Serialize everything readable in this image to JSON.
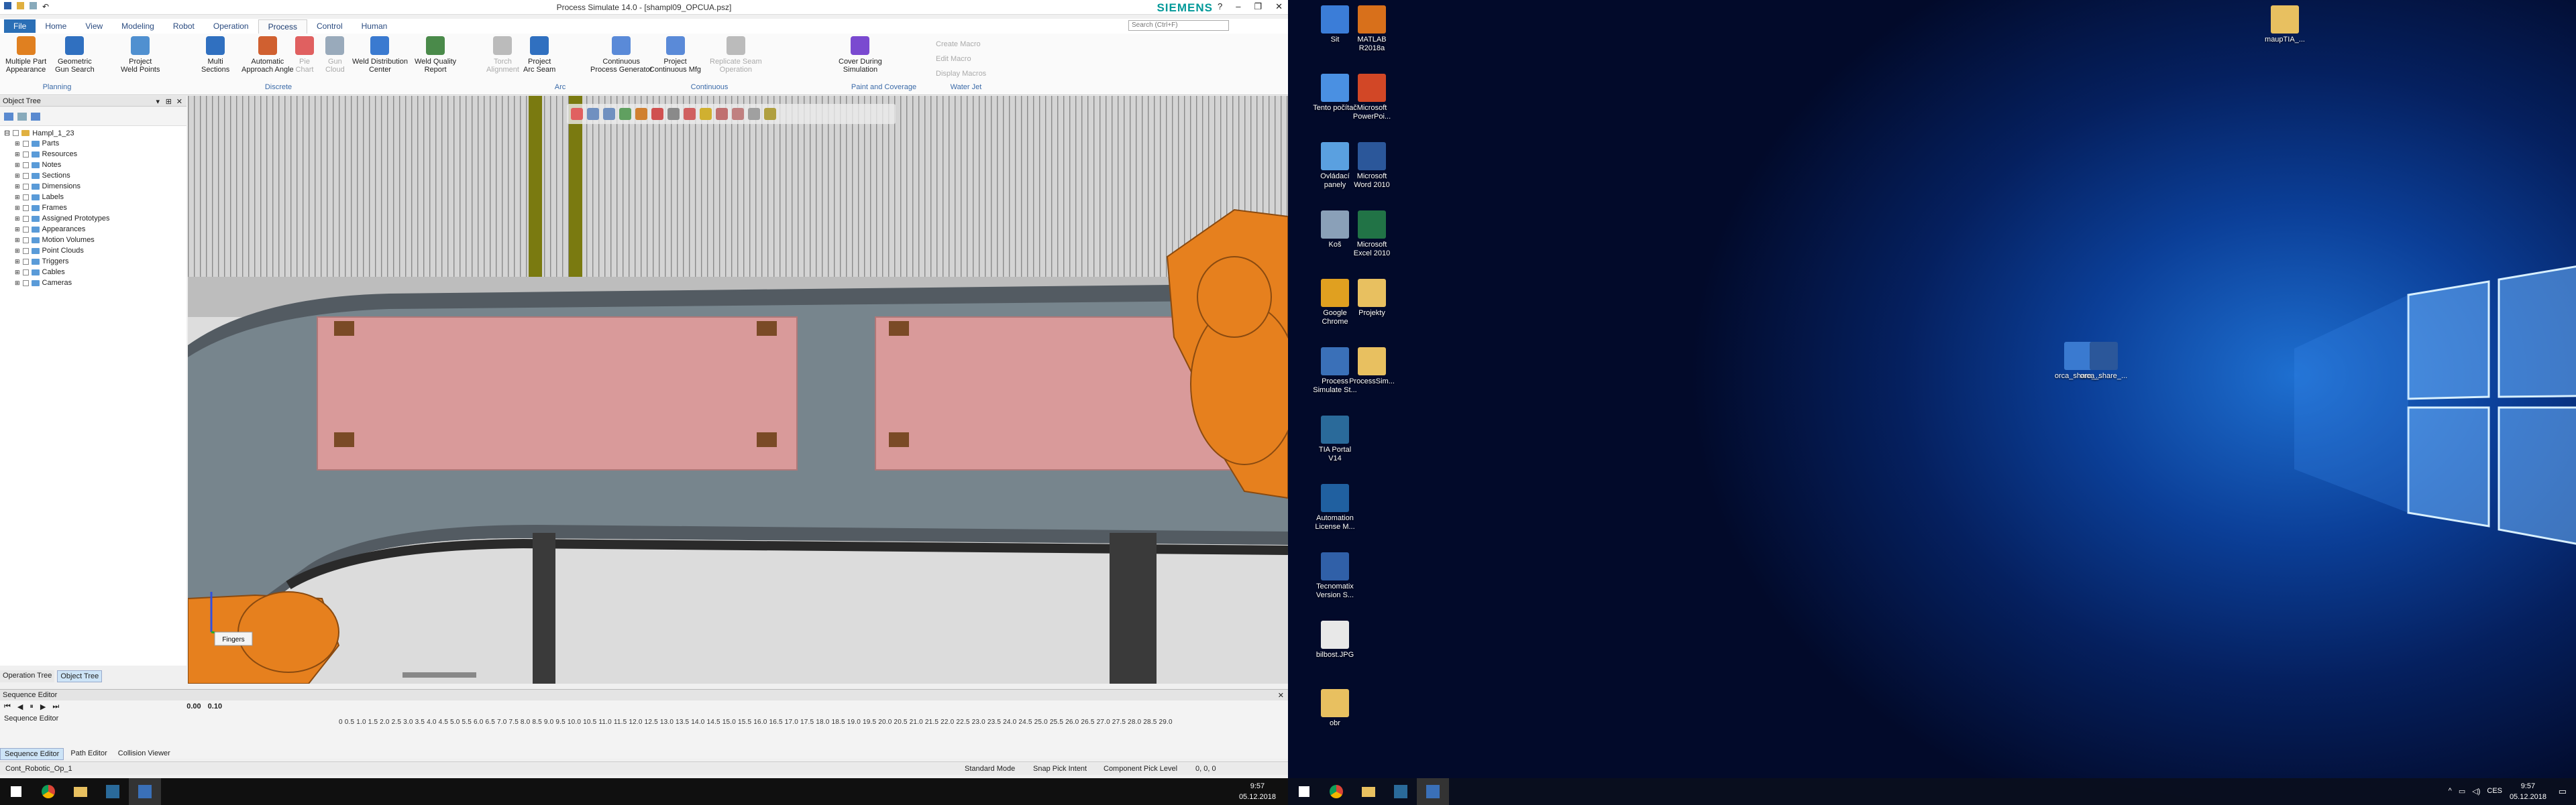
{
  "app": {
    "title": "Process Simulate 14.0 - [shampl09_OPCUA.psz]",
    "brand": "SIEMENS",
    "window_controls": [
      "?",
      "–",
      "❐",
      "✕"
    ],
    "search_placeholder": "Search (Ctrl+F)"
  },
  "menu": [
    "File",
    "Home",
    "View",
    "Modeling",
    "Robot",
    "Operation",
    "Process",
    "Control",
    "Human"
  ],
  "ribbon": {
    "buttons": [
      {
        "label": "Multiple Part\nAppearance",
        "color": "#e08020"
      },
      {
        "label": "Geometric\nGun Search",
        "color": "#3070c0"
      },
      {
        "label": "Project\nWeld Points",
        "color": "#5090d0"
      },
      {
        "label": "Multi\nSections",
        "color": "#3070c0"
      },
      {
        "label": "Automatic\nApproach Angle",
        "color": "#d06030"
      },
      {
        "label": "Pie\nChart",
        "color": "#e06060",
        "disabled": true
      },
      {
        "label": "Gun\nCloud",
        "color": "#9ab",
        "disabled": true
      },
      {
        "label": "Weld Distribution\nCenter",
        "color": "#3a7ad0"
      },
      {
        "label": "Weld Quality\nReport",
        "color": "#4a8a4a"
      },
      {
        "label": "Torch\nAlignment",
        "color": "#bbb",
        "disabled": true
      },
      {
        "label": "Project\nArc Seam",
        "color": "#3070c0"
      },
      {
        "label": "Continuous\nProcess Generator",
        "color": "#5a8ad8"
      },
      {
        "label": "Project\nContinuous Mfg",
        "color": "#5a8ad8"
      },
      {
        "label": "Replicate Seam\nOperation",
        "color": "#bbb",
        "disabled": true
      },
      {
        "label": "Cover During\nSimulation",
        "color": "#7a4ad0"
      }
    ],
    "groups": [
      "Planning",
      "Discrete",
      "Arc",
      "Continuous",
      "Paint and Coverage",
      "Water Jet"
    ],
    "small_commands": [
      "Create Macro",
      "Edit Macro",
      "Display Macros"
    ]
  },
  "object_tree": {
    "title": "Object Tree",
    "root": "Hampl_1_23",
    "items": [
      "Parts",
      "Resources",
      "Notes",
      "Sections",
      "Dimensions",
      "Labels",
      "Frames",
      "Assigned Prototypes",
      "Appearances",
      "Motion Volumes",
      "Point Clouds",
      "Triggers",
      "Cables",
      "Cameras"
    ],
    "tabs": [
      "Operation Tree",
      "Object Tree"
    ]
  },
  "sequence_editor": {
    "title": "Sequence Editor",
    "time_a": "0.00",
    "time_b": "0.10",
    "row_label": "Sequence Editor",
    "ticks": "0  0.5  1.0  1.5  2.0  2.5  3.0  3.5  4.0  4.5  5.0  5.5  6.0  6.5  7.0  7.5  8.0  8.5  9.0  9.5  10.0  10.5  11.0  11.5  12.0  12.5  13.0  13.5  14.0  14.5  15.0  15.5  16.0  16.5  17.0  17.5  18.0  18.5  19.0  19.5  20.0  20.5  21.0  21.5  22.0  22.5  23.0  23.5  24.0  24.5  25.0  25.5  26.0  26.5  27.0  27.5  28.0  28.5  29.0",
    "tabs": [
      "Sequence Editor",
      "Path Editor",
      "Collision Viewer"
    ]
  },
  "status_bar": {
    "operation": "Cont_Robotic_Op_1",
    "mode": "Standard Mode",
    "snap": "Snap Pick Intent",
    "pick": "Component Pick Level",
    "coords": "0, 0, 0"
  },
  "viewport": {
    "tag": "Fingers"
  },
  "taskbar_left": {
    "time": "9:57",
    "date": "05.12.2018"
  },
  "desktop": {
    "icons": [
      {
        "label": "Sit",
        "color": "#3b7dd8"
      },
      {
        "label": "MATLAB\nR2018a",
        "color": "#d8701b"
      },
      {
        "label": "Tento počítač",
        "color": "#4a90e2"
      },
      {
        "label": "Microsoft\nPowerPoi...",
        "color": "#d24726"
      },
      {
        "label": "Ovládací\npanely",
        "color": "#5aa0e0"
      },
      {
        "label": "Microsoft\nWord 2010",
        "color": "#2b579a"
      },
      {
        "label": "Koš",
        "color": "#8aa0b8"
      },
      {
        "label": "Microsoft\nExcel 2010",
        "color": "#217346"
      },
      {
        "label": "Google\nChrome",
        "color": "#e0a020"
      },
      {
        "label": "Projekty",
        "color": "#e8c060"
      },
      {
        "label": "Process\nSimulate St...",
        "color": "#3a70b8"
      },
      {
        "label": "ProcessSim...",
        "color": "#e8c060"
      },
      {
        "label": "TIA Portal\nV14",
        "color": "#2a6a9a"
      },
      {
        "label": "Automation\nLicense M...",
        "color": "#2060a0"
      },
      {
        "label": "Tecnomatix\nVersion S...",
        "color": "#3060a8"
      },
      {
        "label": "bilbost.JPG",
        "color": "#e8e8e8"
      },
      {
        "label": "obr",
        "color": "#e8c060"
      },
      {
        "label": "maupTIA_...",
        "color": "#e8c060"
      },
      {
        "label": "orca_share_...",
        "color": "#3a7ad0"
      },
      {
        "label": "orca_share_...",
        "color": "#2b579a"
      }
    ],
    "tray": {
      "lang": "CES",
      "time": "9:57",
      "date": "05.12.2018"
    }
  }
}
